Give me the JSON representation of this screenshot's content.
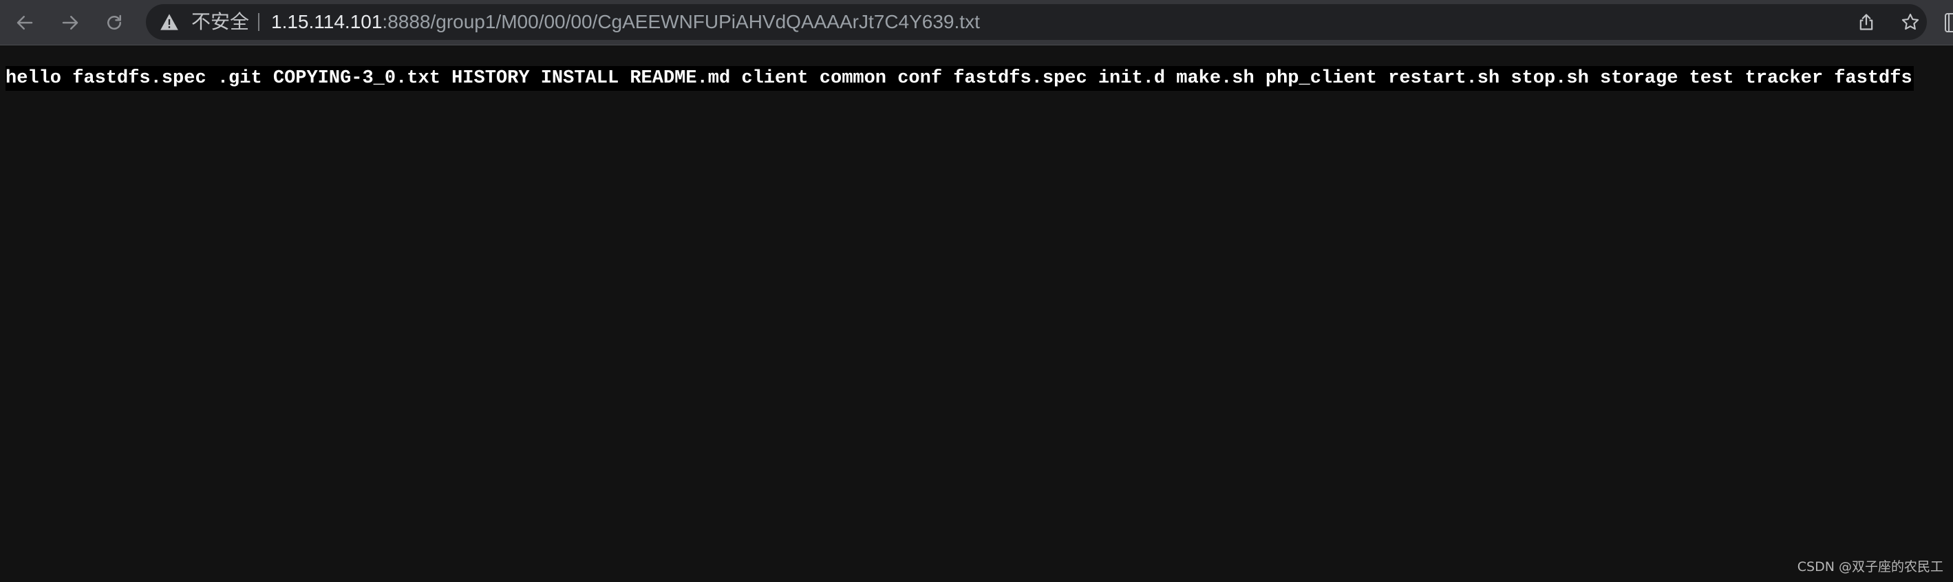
{
  "browser": {
    "address_bar": {
      "security_label": "不安全",
      "url_host": "1.15.114.101",
      "url_path": ":8888/group1/M00/00/00/CgAEEWNFUPiAHVdQAAAArJt7C4Y639.txt"
    },
    "icons": {
      "back": "arrow-left",
      "forward": "arrow-right",
      "reload": "reload",
      "security": "warning-triangle",
      "share": "share",
      "bookmark": "star"
    },
    "colors": {
      "toolbar": "#35363a",
      "omnibox": "#202124",
      "page_background": "#121212"
    }
  },
  "page": {
    "text": "hello fastdfs.spec .git COPYING-3_0.txt HISTORY INSTALL README.md client common conf fastdfs.spec init.d make.sh php_client restart.sh stop.sh storage test tracker fastdfs"
  },
  "watermark": {
    "text": "CSDN @双子座的农民工"
  }
}
